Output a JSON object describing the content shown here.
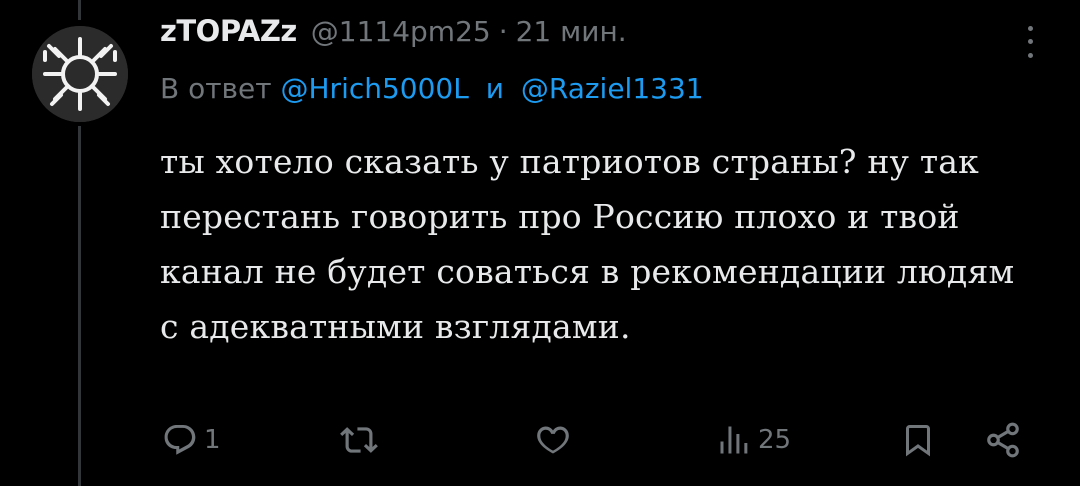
{
  "tweet": {
    "display_name": "zTOPAZz",
    "handle": "@1114pm25",
    "separator": "·",
    "time": "21 мин.",
    "reply_prefix": "В ответ",
    "reply_to": [
      "@Hrich5000L",
      "@Raziel1331"
    ],
    "reply_conjunction": "и",
    "text": "ты хотело сказать у патриотов страны? ну так перестань говорить про Россию плохо и твой канал не будет соваться в рекомендации людям с адекватными взглядами."
  },
  "actions": {
    "reply_count": "1",
    "retweet_count": "",
    "like_count": "",
    "views_count": "25"
  },
  "colors": {
    "background": "#000000",
    "text": "#e7e9ea",
    "secondary": "#71767b",
    "accent": "#1d9bf0"
  },
  "icons": [
    "avatar-burst-icon",
    "more-icon",
    "reply-icon",
    "retweet-icon",
    "like-icon",
    "views-icon",
    "bookmark-icon",
    "share-icon"
  ]
}
